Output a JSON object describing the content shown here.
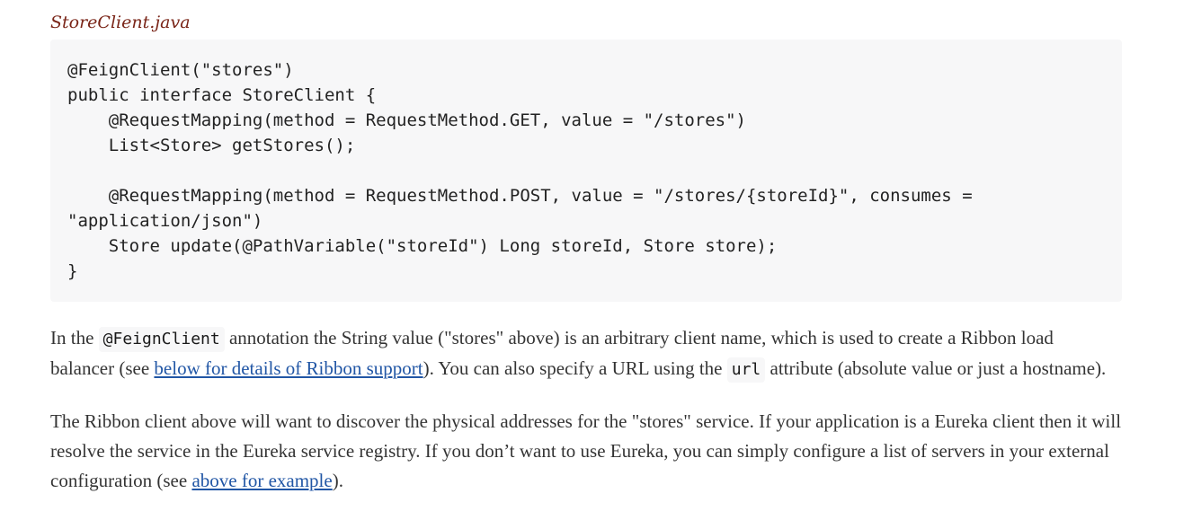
{
  "listing": {
    "title": "StoreClient.java",
    "code_lines": [
      "@FeignClient(\"stores\")",
      "public interface StoreClient {",
      "    @RequestMapping(method = RequestMethod.GET, value = \"/stores\")",
      "    List<Store> getStores();",
      "",
      "    @RequestMapping(method = RequestMethod.POST, value = \"/stores/{storeId}\", consumes =",
      "\"application/json\")",
      "    Store update(@PathVariable(\"storeId\") Long storeId, Store store);",
      "}"
    ]
  },
  "paragraph1": {
    "t1": "In the ",
    "code1": "@FeignClient",
    "t2": " annotation the String value (\"stores\" above) is an arbitrary client name, which is used to create a Ribbon load balancer (see ",
    "link1": "below for details of Ribbon support",
    "t3": "). You can also specify a URL using the ",
    "code2": "url",
    "t4": " attribute (absolute value or just a hostname)."
  },
  "paragraph2": {
    "t1": "The Ribbon client above will want to discover the physical addresses for the \"stores\" service. If your application is a Eureka client then it will resolve the service in the Eureka service registry. If you don’t want to use Eureka, you can simply configure a list of servers in your external configuration (see ",
    "link1": "above for example",
    "t2": ")."
  },
  "colors": {
    "title": "#7a2518",
    "link": "#2156a5",
    "code_background": "#f7f7f8"
  }
}
